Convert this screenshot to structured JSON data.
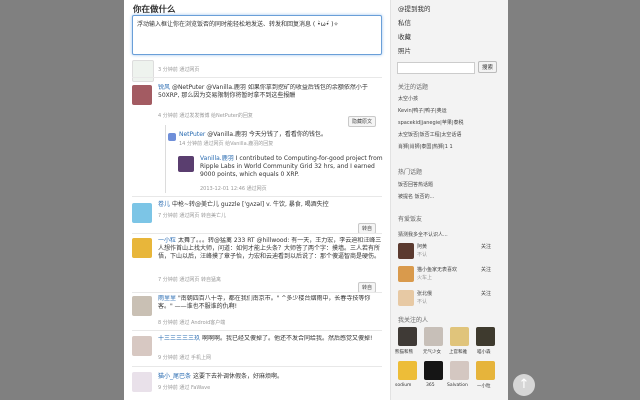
{
  "compose": {
    "title": "你在做什么",
    "text": "浮动输入框让你在浏览饭否的同时能轻松地发送、转发和回复消息 ( •̀ω•́ )✧"
  },
  "timeline": [
    {
      "meta": "3 分钟前  通过网页"
    },
    {
      "user": "锐风",
      "text": "@NetPuter @Vanilla.鹿羽 如果你拿到挖矿的收益后钱包的余额依然小于 50XRP, 那么因为交易限制你将暂时拿不到这些报酬",
      "meta": "4 分钟前  通过发发微博  给NetPuter的回复",
      "btn": "隐藏原文"
    },
    {
      "user": "NetPuter",
      "text": "@Vanilla.鹿羽 今天分钱了，看看你的钱包。",
      "meta": "14 分钟前  通过网页  给Vanilla.鹿羽的回复"
    },
    {
      "user": "Vanilla.鹿羽",
      "text": "I contributed to Computing-for-good project from Ripple Labs in World Community Grid 32 hrs, and I earned 9000 points, which equals 0 XRP.",
      "meta": "2013-12-01 12:46  通过网页"
    },
    {
      "user": "卷儿",
      "text": "中枪~转@美亡儿 guzzle ['gʌzəl] v. 牛饮, 暴食, 喝酒失控",
      "meta": "7 分钟前  通过网页  转自美亡儿",
      "btn": "转自"
    },
    {
      "user": "一小粒",
      "text": "太舞了。。。转@猛禽 233 RT @hillwood: 有一天，王力宏，李云迪和汪峰三人想作首山上找大师，问道：如何才能上头条？大师答了两个字：摸墙。三人若有所悟，下山以后，汪峰摸了章子怡，力宏和云迪看到以后说了：那个傻逼智商是硬伤。",
      "meta": "7 分钟前  通过网页  转自猛禽",
      "btn": "转自"
    },
    {
      "user": "雨里里",
      "text": "\"南朝四百八十寺，都在我们南京市。\" ^多少楼台烟雨中，长春寺技等你客。\" ——谁也不服谁的仇啊!",
      "meta": "8 分钟前  通过 Android客户端"
    },
    {
      "user": "十三三三三三玖",
      "text": "啊啊啊。我已经又傻掉了。他还不发合同给我。然后感觉又傻掉!",
      "meta": "9 分钟前  通过 手机上网"
    },
    {
      "user": "猫小_尾巴条",
      "text": "这要下去补调休假条，好麻烦啊。",
      "meta": "9 分钟前  通过 FaWave"
    }
  ],
  "sidebar": {
    "links": [
      "@提到我的",
      "私信",
      "收藏",
      "照片"
    ],
    "search_btn": "搜索",
    "topics_title": "关注的话题",
    "topics": [
      "太空小孩",
      "Kevin|鸭子|鸭子|奥运",
      "spacekid|janegie|苹果|泰税",
      "太空饭否|饭否工程|太空话语",
      "肖狮|肖狮|泰国|热狮|1 1"
    ],
    "hot_title": "热门话题",
    "hot": [
      "饭否回答热话题",
      "被提名 饭否的..."
    ],
    "recommend_title": "有爱饭友",
    "recommend_sub": "猜测我多全不认识人...",
    "rec_users": [
      {
        "name": "阿黄",
        "action": "关注",
        "note": "不认"
      },
      {
        "name": "猫小鱼家无表喜欢",
        "action": "关注",
        "note": "火车上"
      },
      {
        "name": "张北俄",
        "action": "关注",
        "note": "不认"
      }
    ],
    "following_title": "我关注的人",
    "following": [
      "熊猫和熊",
      "元气少女",
      "上官和雅",
      "喵小森",
      "sodium",
      "365",
      "Salvation",
      "一小粒"
    ]
  },
  "scroll_up": "↑"
}
